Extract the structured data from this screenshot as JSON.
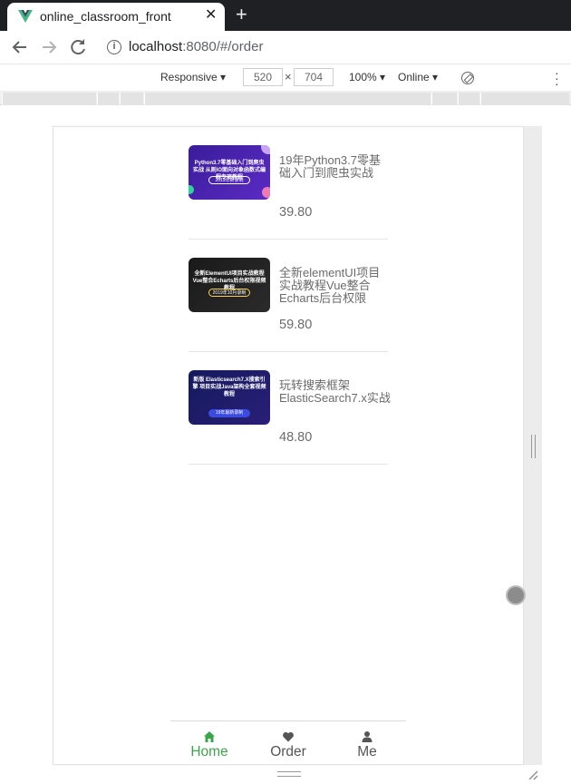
{
  "browser": {
    "tab_title": "online_classroom_front",
    "tab_close": "✕",
    "new_tab": "+",
    "url_host": "localhost",
    "url_rest": ":8080/#/order"
  },
  "device_toolbar": {
    "mode": "Responsive ▾",
    "width": "520",
    "height": "704",
    "times": "×",
    "zoom": "100% ▾",
    "network": "Online ▾"
  },
  "courses": [
    {
      "title": "19年Python3.7零基础入门到爬虫实战",
      "price": "39.80",
      "thumb_text": "Python3.7零基础入门到爬虫实战 从则IO面向对象函数式编程专项教程",
      "thumb_pill": "2019年新录制",
      "thumb_colors": [
        "#3a1c9a",
        "#5b2bc4"
      ]
    },
    {
      "title": "全新elementUI项目实战教程Vue整合Echarts后台权限",
      "price": "59.80",
      "thumb_text": "全新ElementUI项目实战教程 Vue整合Echarts后台权限视频教程",
      "thumb_pill": "2019年10月录制",
      "thumb_colors": [
        "#1a1a1a",
        "#2b2b2b"
      ]
    },
    {
      "title": "玩转搜索框架ElasticSearch7.x实战",
      "price": "48.80",
      "thumb_text": "新版 Elasticsearch7.X搜索引擎 项目实战Java架构全套视频教程",
      "thumb_pill": "19年最新录制",
      "thumb_colors": [
        "#141a5c",
        "#2a1f78"
      ]
    }
  ],
  "bottom_nav": {
    "items": [
      {
        "label": "Home",
        "icon": "home-icon",
        "active": true
      },
      {
        "label": "Order",
        "icon": "heart-icon",
        "active": false
      },
      {
        "label": "Me",
        "icon": "person-icon",
        "active": false
      }
    ]
  },
  "colors": {
    "accent": "#3aa54a",
    "text_gray": "#6b6b6b"
  }
}
